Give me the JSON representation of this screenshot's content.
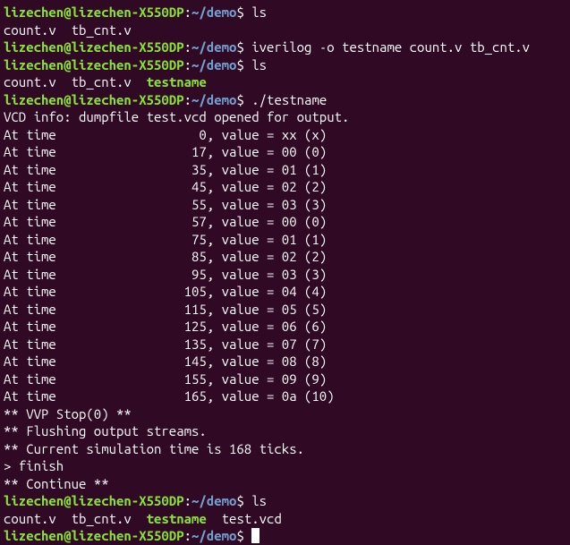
{
  "prompt": {
    "user_host": "lizechen@lizechen-X550DP",
    "colon": ":",
    "tilde": "~",
    "path": "/demo",
    "dollar": "$"
  },
  "commands": {
    "ls1": "ls",
    "iverilog": "iverilog -o testname count.v tb_cnt.v",
    "ls2": "ls",
    "run": "./testname",
    "ls3": "ls"
  },
  "ls_out1": {
    "f1": "count.v",
    "f2": "tb_cnt.v"
  },
  "ls_out2": {
    "f1": "count.v",
    "f2": "tb_cnt.v",
    "f3": "testname"
  },
  "ls_out3": {
    "f1": "count.v",
    "f2": "tb_cnt.v",
    "f3": "testname",
    "f4": "test.vcd"
  },
  "vcd_info": "VCD info: dumpfile test.vcd opened for output.",
  "sim_lines": [
    "At time                   0, value = xx (x)",
    "At time                  17, value = 00 (0)",
    "At time                  35, value = 01 (1)",
    "At time                  45, value = 02 (2)",
    "At time                  55, value = 03 (3)",
    "At time                  57, value = 00 (0)",
    "At time                  75, value = 01 (1)",
    "At time                  85, value = 02 (2)",
    "At time                  95, value = 03 (3)",
    "At time                 105, value = 04 (4)",
    "At time                 115, value = 05 (5)",
    "At time                 125, value = 06 (6)",
    "At time                 135, value = 07 (7)",
    "At time                 145, value = 08 (8)",
    "At time                 155, value = 09 (9)",
    "At time                 165, value = 0a (10)"
  ],
  "footer": {
    "vvp_stop": "** VVP Stop(0) **",
    "flush": "** Flushing output streams.",
    "simtime": "** Current simulation time is 168 ticks.",
    "finish": "> finish",
    "continue": "** Continue **"
  }
}
